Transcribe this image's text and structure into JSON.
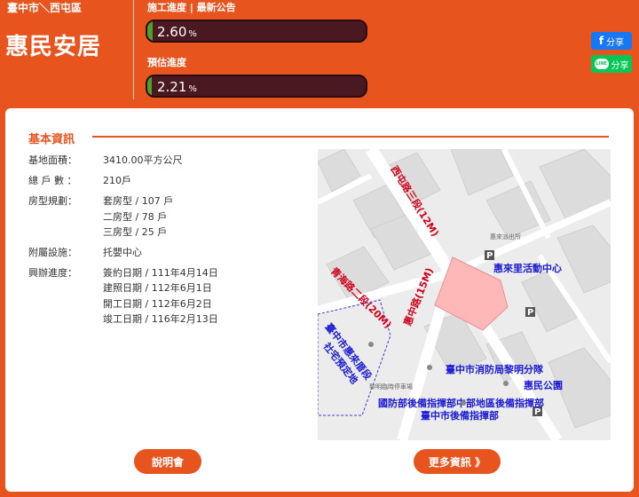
{
  "header": {
    "location": "臺中市＼西屯區",
    "title": "惠民安居",
    "construction_label": "施工進度 | 最新公告",
    "construction_value": "2.60",
    "construction_percent": 2.6,
    "estimated_label": "預估進度",
    "estimated_value": "2.21",
    "estimated_percent": 2.21,
    "percent_unit": "%"
  },
  "share": {
    "facebook_label": "分享",
    "line_label": "分享",
    "line_glyph": "LINE"
  },
  "basic": {
    "section_title": "基本資訊",
    "area_label": "基地面積：",
    "area_value": "3410.00平方公尺",
    "units_label": "總 戶 數 ：",
    "units_value": "210戶",
    "room_label": "房型規劃：",
    "rooms": [
      "套房型 / 107 戶",
      "二房型 / 78 戶",
      "三房型 / 25 戶"
    ],
    "facility_label": "附屬設施：",
    "facility_value": "托嬰中心",
    "progress_label": "興辦進度：",
    "progress": [
      "簽約日期 / 111年4月14日",
      "建照日期 / 112年6月1日",
      "開工日期 / 112年6月2日",
      "竣工日期 / 116年2月13日"
    ]
  },
  "map": {
    "road_xitun": "西屯路三段(12M)",
    "road_qinghai": "青海路二段(20M)",
    "road_huizhong": "惠中路(15M)",
    "poi_activity": "惠來里活動中心",
    "poi_fire": "臺中市消防局黎明分隊",
    "poi_park": "惠民公園",
    "poi_defense": "國防部後備指揮部中部地區後備指揮部",
    "poi_reserve": "臺中市後備指揮部",
    "poi_social": "臺中市惠來厝段",
    "poi_social2": "社宅預定地",
    "poi_police": "惠來派出所",
    "poi_parking": "黎明臨時停車場",
    "parking_glyph": "P",
    "colors": {
      "road_label": "#d0021b",
      "poi": "#1a1ad6",
      "site_fill": "#ffb8b8"
    }
  },
  "buttons": {
    "brief": "說明會",
    "more": "更多資訊 》"
  }
}
